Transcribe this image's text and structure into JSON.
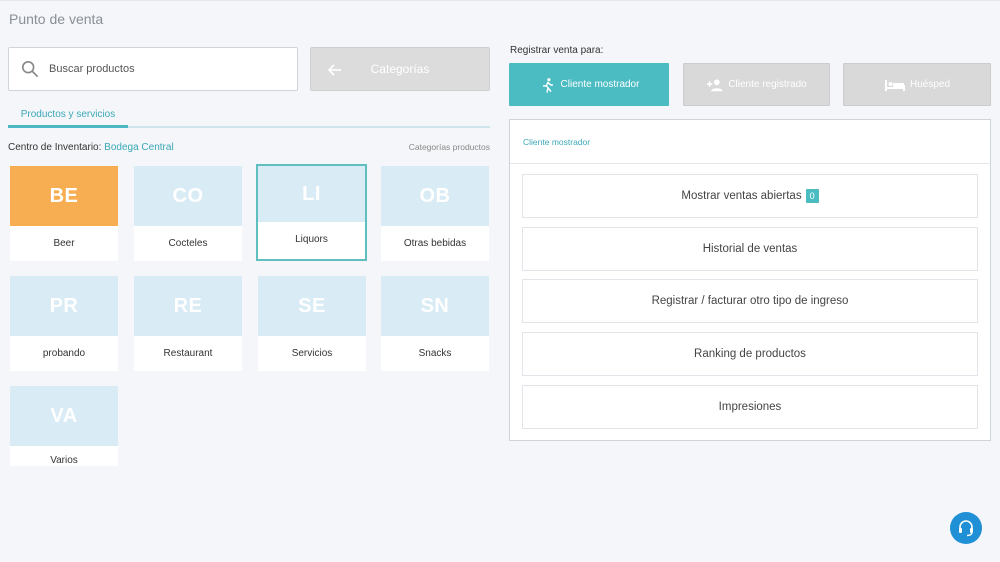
{
  "header": {
    "title": "Punto de venta"
  },
  "search": {
    "placeholder": "Buscar productos",
    "icon": "search-icon"
  },
  "categories_button": {
    "label": "Categorías",
    "icon": "arrow-left-icon"
  },
  "tabs": [
    {
      "label": "Productos y servicios",
      "active": true
    }
  ],
  "inventory": {
    "label": "Centro de Inventario:",
    "value": "Bodega Central",
    "link": "Categorías productos"
  },
  "tiles": [
    {
      "abbr": "BE",
      "name": "Beer"
    },
    {
      "abbr": "CO",
      "name": "Cocteles"
    },
    {
      "abbr": "LI",
      "name": "Liquors"
    },
    {
      "abbr": "OB",
      "name": "Otras bebidas"
    },
    {
      "abbr": "PR",
      "name": "probando"
    },
    {
      "abbr": "RE",
      "name": "Restaurant"
    },
    {
      "abbr": "SE",
      "name": "Servicios"
    },
    {
      "abbr": "SN",
      "name": "Snacks"
    },
    {
      "abbr": "VA",
      "name": "Varios"
    }
  ],
  "register": {
    "label": "Registrar venta para:",
    "options": [
      {
        "label": "Cliente mostrador",
        "icon": "walking-person-icon",
        "active": true
      },
      {
        "label": "Cliente registrado",
        "icon": "add-user-icon",
        "active": false
      },
      {
        "label": "Huésped",
        "icon": "bed-icon",
        "active": false
      }
    ]
  },
  "panel": {
    "header": "Cliente mostrador",
    "actions": [
      {
        "label": "Mostrar ventas abiertas",
        "badge": "0"
      },
      {
        "label": "Historial de ventas"
      },
      {
        "label": "Registrar / facturar otro tipo de ingreso"
      },
      {
        "label": "Ranking de productos"
      },
      {
        "label": "Impresiones"
      }
    ]
  },
  "support": {
    "icon": "headset-icon"
  },
  "colors": {
    "accent": "#4bbcc2",
    "beer_tile": "#f7ae52",
    "tile_default": "#d9ebf5",
    "support": "#1f8fd6"
  }
}
